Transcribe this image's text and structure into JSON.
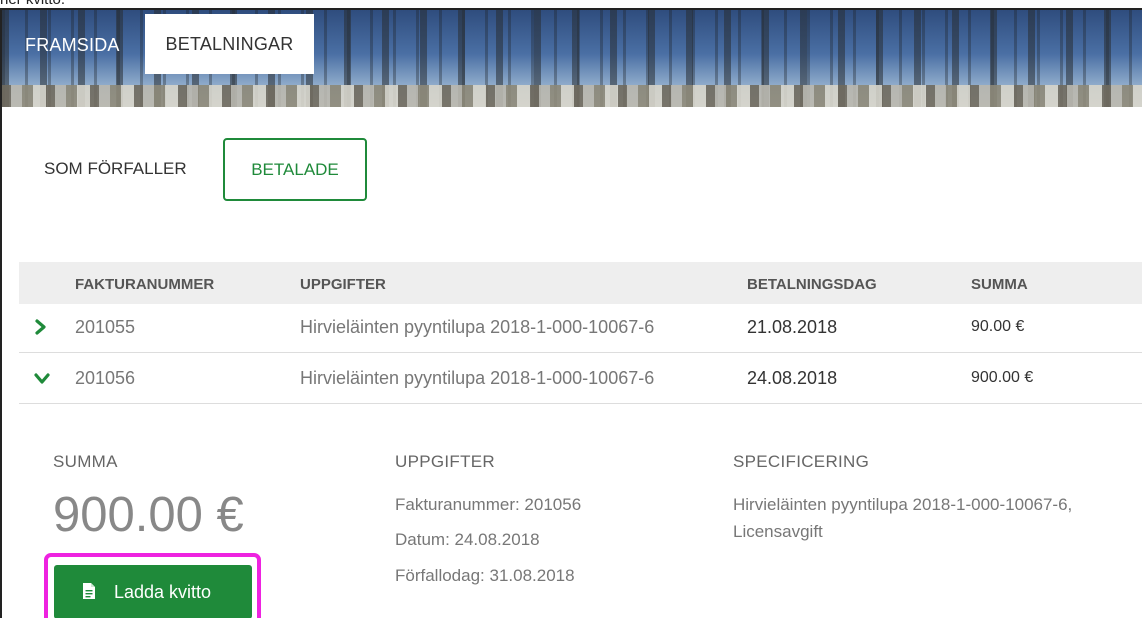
{
  "top_caption": "ner kvitto.",
  "nav": {
    "home_label": "FRAMSIDA",
    "payments_label": "BETALNINGAR"
  },
  "subtabs": {
    "upcoming_label": "SOM FÖRFALLER",
    "paid_label": "BETALADE"
  },
  "table": {
    "headers": {
      "invoice": "FAKTURANUMMER",
      "details": "UPPGIFTER",
      "payment_date": "BETALNINGSDAG",
      "sum": "SUMMA"
    },
    "rows": [
      {
        "invoice": "201055",
        "details": "Hirvieläinten pyyntilupa 2018-1-000-10067-6",
        "payment_date": "21.08.2018",
        "sum": "90.00 €",
        "expanded": false
      },
      {
        "invoice": "201056",
        "details": "Hirvieläinten pyyntilupa 2018-1-000-10067-6",
        "payment_date": "24.08.2018",
        "sum": "900.00 €",
        "expanded": true
      }
    ]
  },
  "detail": {
    "sum_label": "SUMMA",
    "sum_value": "900.00 €",
    "details_label": "UPPGIFTER",
    "invoice_line": "Fakturanummer: 201056",
    "date_line": "Datum: 24.08.2018",
    "due_line": "Förfallodag: 31.08.2018",
    "spec_label": "SPECIFICERING",
    "spec_line1": "Hirvieläinten pyyntilupa 2018-1-000-10067-6,",
    "spec_line2": "Licensavgift",
    "receipt_button": "Ladda kvitto"
  },
  "colors": {
    "accent": "#1f8a3a",
    "highlight": "#ee22e0"
  },
  "icons": {
    "collapsed_row": "chevron-right-icon",
    "expanded_row": "chevron-down-icon",
    "receipt": "document-icon"
  }
}
